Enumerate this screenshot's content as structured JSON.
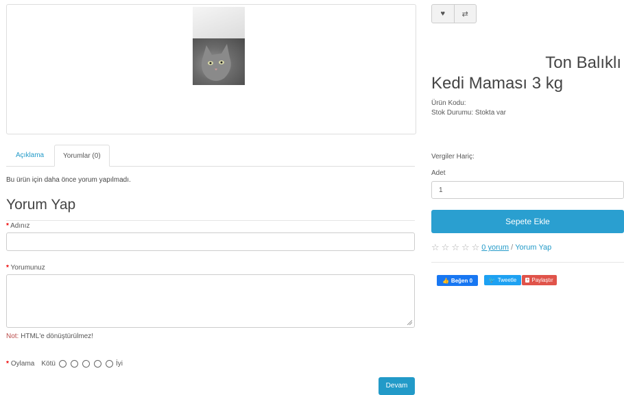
{
  "tabs": {
    "description": "Açıklama",
    "reviews": "Yorumlar (0)"
  },
  "reviews": {
    "empty_text": "Bu ürün için daha önce yorum yapılmadı.",
    "heading": "Yorum Yap",
    "name_label": "Adınız",
    "name_value": "",
    "comment_label": "Yorumunuz",
    "comment_value": "",
    "note_prefix": "Not:",
    "note_text": " HTML'e dönüştürülmez!",
    "rating_label": "Oylama",
    "rating_bad": "Kötü",
    "rating_good": "İyi",
    "submit_label": "Devam"
  },
  "product": {
    "title_line1": "Ton Balıklı",
    "title_line2": "Kedi Maması 3 kg",
    "code_label": "Ürün Kodu:",
    "stock_label": "Stok Durumu: Stokta var",
    "tax_label": "Vergiler Hariç:",
    "qty_label": "Adet",
    "qty_value": "1",
    "add_to_cart": "Sepete Ekle",
    "review_count_link": "0 yorum",
    "separator": " / ",
    "write_review_link": "Yorum Yap"
  },
  "social": {
    "like": "Beğen 0",
    "tweet": "Tweetle",
    "share": "Paylaştır"
  },
  "colors": {
    "accent": "#229ac8",
    "required": "#ee0000",
    "facebook": "#1877f2",
    "twitter": "#1da1f2",
    "share": "#e0534a"
  }
}
